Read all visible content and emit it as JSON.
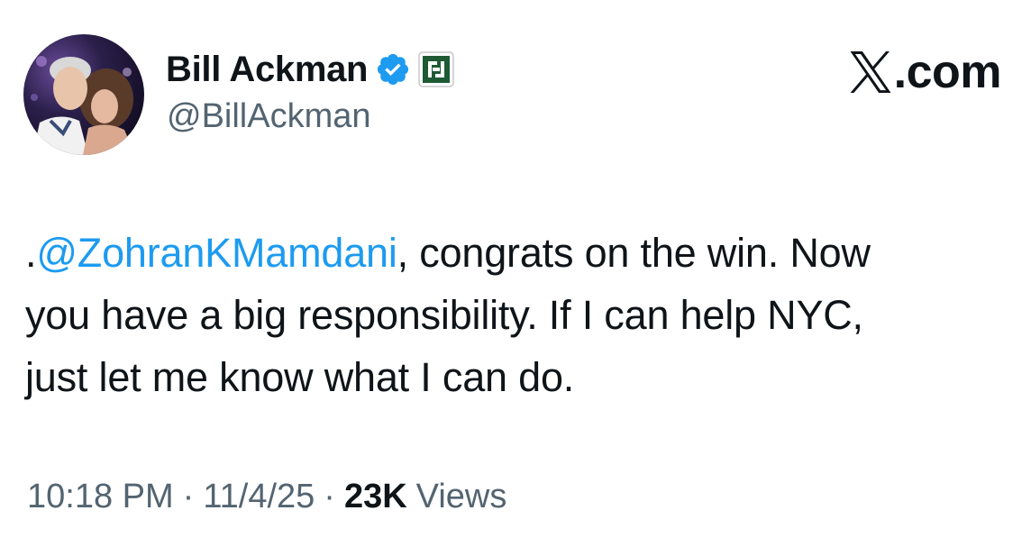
{
  "author": {
    "display_name": "Bill Ackman",
    "handle": "@BillAckman",
    "verified": true,
    "badge_color": "#1d9bf0",
    "affiliate_badge_color": "#1f5a35"
  },
  "brand": {
    "icon": "x-logo-icon",
    "suffix": ".com"
  },
  "tweet": {
    "line1_prefix": ".",
    "mention": "@ZohranKMamdani",
    "line1_rest": ", congrats on the win. Now",
    "line2": "you have a big responsibility. If I can help NYC,",
    "line3": "just let me know what I can do."
  },
  "meta": {
    "time": "10:18 PM",
    "separator": "·",
    "date": "11/4/25",
    "views_count": "23K",
    "views_label": "Views"
  },
  "colors": {
    "text": "#0f1419",
    "secondary": "#536471",
    "link": "#1d9bf0",
    "background": "#ffffff"
  }
}
